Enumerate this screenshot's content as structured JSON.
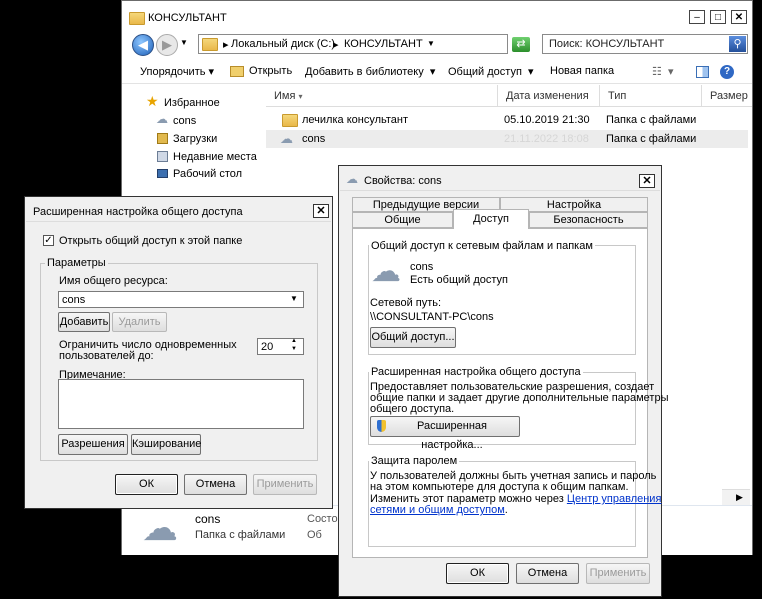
{
  "explorer": {
    "title": "КОНСУЛЬТАНТ",
    "address": {
      "drive": "Локальный диск (C:)",
      "sep": "▸",
      "folder": "КОНСУЛЬТАНТ"
    },
    "search_placeholder": "Поиск: КОНСУЛЬТАНТ",
    "toolbar": {
      "organize": "Упорядочить",
      "open": "Открыть",
      "add_library": "Добавить в библиотеку",
      "share": "Общий доступ",
      "new_folder": "Новая папка"
    },
    "sidebar": [
      {
        "label": "Избранное",
        "icon": "star-icon"
      },
      {
        "label": "cons",
        "icon": "cloud-icon"
      },
      {
        "label": "Загрузки",
        "icon": "downloads-icon"
      },
      {
        "label": "Недавние места",
        "icon": "recent-places-icon"
      },
      {
        "label": "Рабочий стол",
        "icon": "desktop-icon"
      }
    ],
    "columns": [
      "Имя",
      "Дата изменения",
      "Тип",
      "Размер"
    ],
    "rows": [
      {
        "name": "лечилка консультант",
        "date": "05.10.2019 21:30",
        "type": "Папка с файлами"
      },
      {
        "name": "cons",
        "date": "21.11.2022 18:08",
        "type": "Папка с файлами"
      }
    ],
    "details": {
      "name": "cons",
      "state_label": "Состо",
      "type": "Папка с файлами",
      "extra": "Об"
    }
  },
  "advanced": {
    "title": "Расширенная настройка общего доступа",
    "share_checkbox": "Открыть общий доступ к этой папке",
    "params_label": "Параметры",
    "share_name_label": "Имя общего ресурса:",
    "share_name_value": "cons",
    "add": "Добавить",
    "remove": "Удалить",
    "limit_label_1": "Ограничить число одновременных",
    "limit_label_2": "пользователей до:",
    "limit_value": "20",
    "comments_label": "Примечание:",
    "permissions": "Разрешения",
    "caching": "Кэширование",
    "ok": "ОК",
    "cancel": "Отмена",
    "apply": "Применить"
  },
  "props": {
    "title": "Свойства: cons",
    "tabs_top": [
      "Предыдущие версии",
      "Настройка"
    ],
    "tabs_bottom": [
      "Общие",
      "Доступ",
      "Безопасность"
    ],
    "net_group": "Общий доступ к сетевым файлам и папкам",
    "share_name": "cons",
    "share_state": "Есть общий доступ",
    "net_path_label": "Сетевой путь:",
    "net_path": "\\\\CONSULTANT-PC\\cons",
    "share_button": "Общий доступ...",
    "adv_group": "Расширенная настройка общего доступа",
    "adv_text": [
      "Предоставляет пользовательские разрешения, создает",
      "общие папки и задает другие дополнительные параметры",
      "общего доступа."
    ],
    "adv_button": "Расширенная настройка...",
    "pwd_group": "Защита паролем",
    "pwd_text": [
      "У пользователей должны быть учетная запись и пароль",
      "на этом компьютере для доступа к общим папкам.",
      "Изменить этот параметр можно через "
    ],
    "pwd_link_1": "Центр управления",
    "pwd_link_2": "сетями и общим доступом",
    "pwd_link_end": ".",
    "ok": "ОК",
    "cancel": "Отмена",
    "apply": "Применить"
  }
}
